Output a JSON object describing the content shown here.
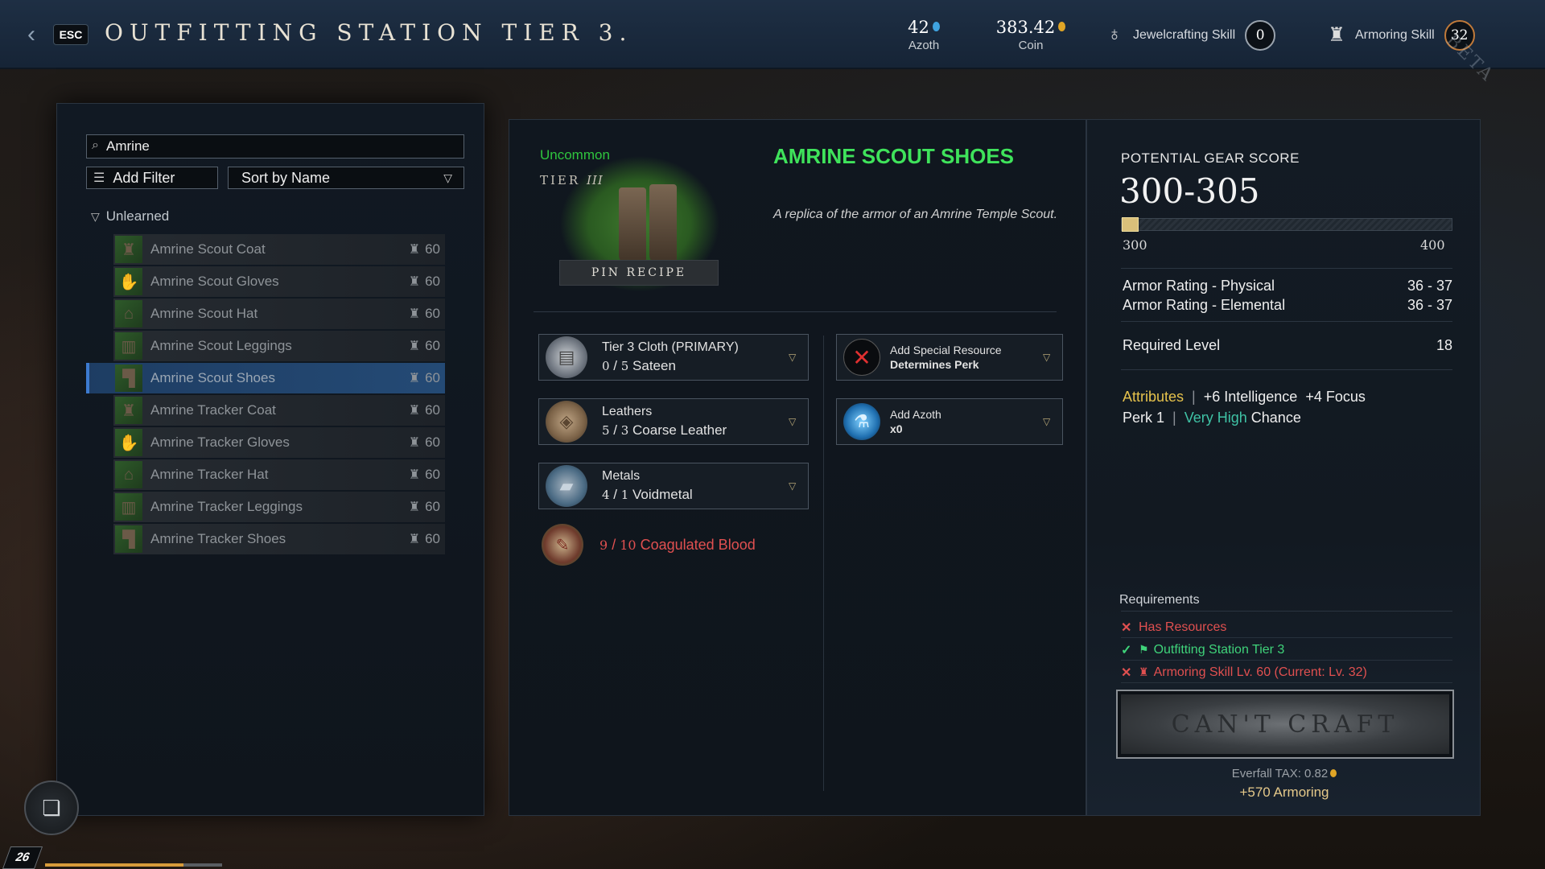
{
  "header": {
    "esc_label": "ESC",
    "title": "OUTFITTING STATION TIER 3.",
    "azoth_value": "42",
    "azoth_label": "Azoth",
    "coin_value": "383.42",
    "coin_label": "Coin",
    "jewelcrafting_label": "Jewelcrafting Skill",
    "jewelcrafting_level": "0",
    "armoring_label": "Armoring Skill",
    "armoring_level": "32",
    "watermark": "BETA",
    "colors": {
      "azoth": "#3fa3e0",
      "coin": "#e0a526"
    }
  },
  "left": {
    "search_value": "Amrine",
    "add_filter_label": "Add Filter",
    "sort_label": "Sort by Name",
    "section_label": "Unlearned",
    "recipes": [
      {
        "name": "Amrine Scout Coat",
        "level": "60",
        "selected": false
      },
      {
        "name": "Amrine Scout Gloves",
        "level": "60",
        "selected": false
      },
      {
        "name": "Amrine Scout Hat",
        "level": "60",
        "selected": false
      },
      {
        "name": "Amrine Scout Leggings",
        "level": "60",
        "selected": false
      },
      {
        "name": "Amrine Scout Shoes",
        "level": "60",
        "selected": true
      },
      {
        "name": "Amrine Tracker Coat",
        "level": "60",
        "selected": false
      },
      {
        "name": "Amrine Tracker Gloves",
        "level": "60",
        "selected": false
      },
      {
        "name": "Amrine Tracker Hat",
        "level": "60",
        "selected": false
      },
      {
        "name": "Amrine Tracker Leggings",
        "level": "60",
        "selected": false
      },
      {
        "name": "Amrine Tracker Shoes",
        "level": "60",
        "selected": false
      }
    ]
  },
  "item": {
    "rarity": "Uncommon",
    "tier_word": "TIER",
    "tier_numeral": "III",
    "pin_label": "PIN RECIPE",
    "name": "AMRINE SCOUT SHOES",
    "description": "A replica of the armor of an Amrine Temple Scout.",
    "rarity_color": "#2fc53e"
  },
  "ingredients": {
    "cloth": {
      "category": "Tier 3 Cloth (PRIMARY)",
      "have": "0",
      "sep": "/",
      "need": "5",
      "material": "Sateen"
    },
    "leathers": {
      "category": "Leathers",
      "have": "5",
      "sep": "/",
      "need": "3",
      "material": "Coarse Leather"
    },
    "metals": {
      "category": "Metals",
      "have": "4",
      "sep": "/",
      "need": "1",
      "material": "Voidmetal"
    },
    "blood": {
      "have": "9",
      "sep": "/",
      "need": "10",
      "material": "Coagulated Blood"
    },
    "special": {
      "label": "Add Special Resource",
      "sub": "Determines Perk"
    },
    "azoth": {
      "label": "Add Azoth",
      "sub": "x0"
    }
  },
  "stats": {
    "gear_score_label": "POTENTIAL GEAR SCORE",
    "gear_score_value": "300-305",
    "gs_min": "300",
    "gs_max": "400",
    "gs_fill_fraction": 0.05,
    "armor_physical_label": "Armor Rating - Physical",
    "armor_physical_value": "36 - 37",
    "armor_elemental_label": "Armor Rating - Elemental",
    "armor_elemental_value": "36 - 37",
    "required_level_label": "Required Level",
    "required_level_value": "18",
    "attributes_label": "Attributes",
    "attr_1": "+6 Intelligence",
    "attr_2": "+4 Focus",
    "perk_label": "Perk 1",
    "perk_chance_level": "Very High",
    "perk_chance_word": "Chance"
  },
  "requirements": {
    "title": "Requirements",
    "items": [
      {
        "text": "Has Resources",
        "met": false
      },
      {
        "text": "Outfitting Station Tier 3",
        "met": true
      },
      {
        "text": "Armoring Skill Lv. 60 (Current: Lv. 32)",
        "met": false
      }
    ]
  },
  "craft": {
    "button_label": "CAN'T CRAFT",
    "tax_label": "Everfall TAX: 0.82",
    "xp_label": "+570 Armoring"
  },
  "hud": {
    "player_level": "26",
    "xp_fraction": 0.78
  }
}
